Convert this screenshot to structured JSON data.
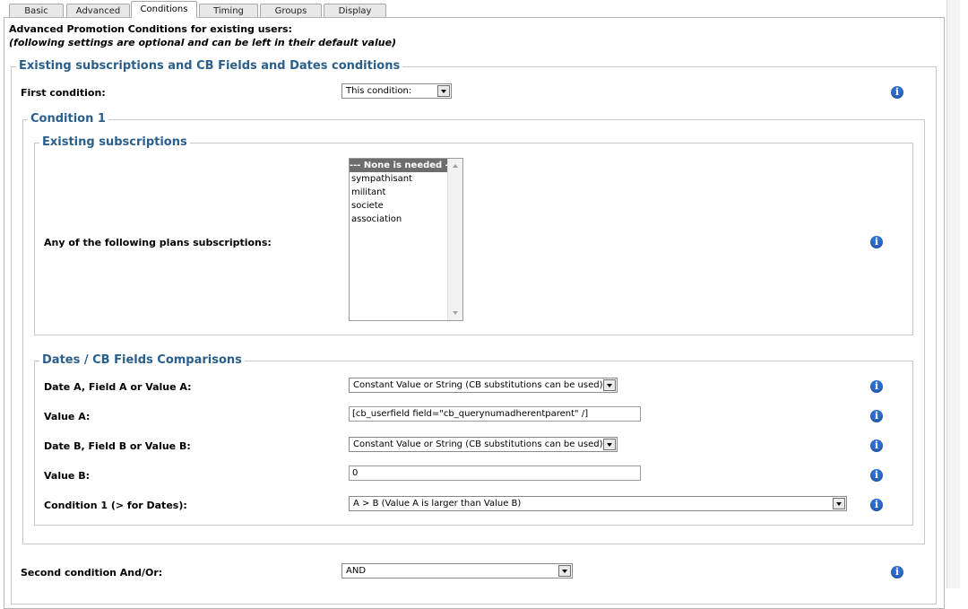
{
  "tabs": [
    {
      "label": "Basic"
    },
    {
      "label": "Advanced"
    },
    {
      "label": "Conditions"
    },
    {
      "label": "Timing"
    },
    {
      "label": "Groups"
    },
    {
      "label": "Display"
    }
  ],
  "active_tab": "Conditions",
  "intro": {
    "line1": "Advanced Promotion Conditions for existing users:",
    "line2": "(following settings are optional and can be left in their default value)"
  },
  "section_main": {
    "legend": "Existing subscriptions and CB Fields and Dates conditions",
    "first_condition_label": "First condition:",
    "first_condition_value": "This condition:"
  },
  "condition1": {
    "legend": "Condition 1",
    "existing_subs": {
      "legend": "Existing subscriptions",
      "label": "Any of the following plans subscriptions:",
      "options": [
        "--- None is needed ---",
        "sympathisant",
        "militant",
        "societe",
        "association"
      ],
      "selected_index": 0
    },
    "dates": {
      "legend": "Dates / CB Fields Comparisons",
      "date_a_label": "Date A, Field A or Value A:",
      "date_a_value": "Constant Value or String (CB substitutions can be used)",
      "value_a_label": "Value A:",
      "value_a_value": "[cb_userfield field=\"cb_querynumadherentparent\" /]",
      "date_b_label": "Date B, Field B or Value B:",
      "date_b_value": "Constant Value or String (CB substitutions can be used)",
      "value_b_label": "Value B:",
      "value_b_value": "0",
      "condition_label": "Condition 1 (> for Dates):",
      "condition_value": "A > B (Value A is larger than Value B)"
    }
  },
  "second_condition": {
    "label": "Second condition And/Or:",
    "value": "AND"
  },
  "icons": {
    "info": "info-icon",
    "info_glyph": "i"
  },
  "colors": {
    "legend_text": "#2a5f8c",
    "info_icon": "#2e6fd1",
    "selected_option_bg": "#6d6d6d"
  }
}
